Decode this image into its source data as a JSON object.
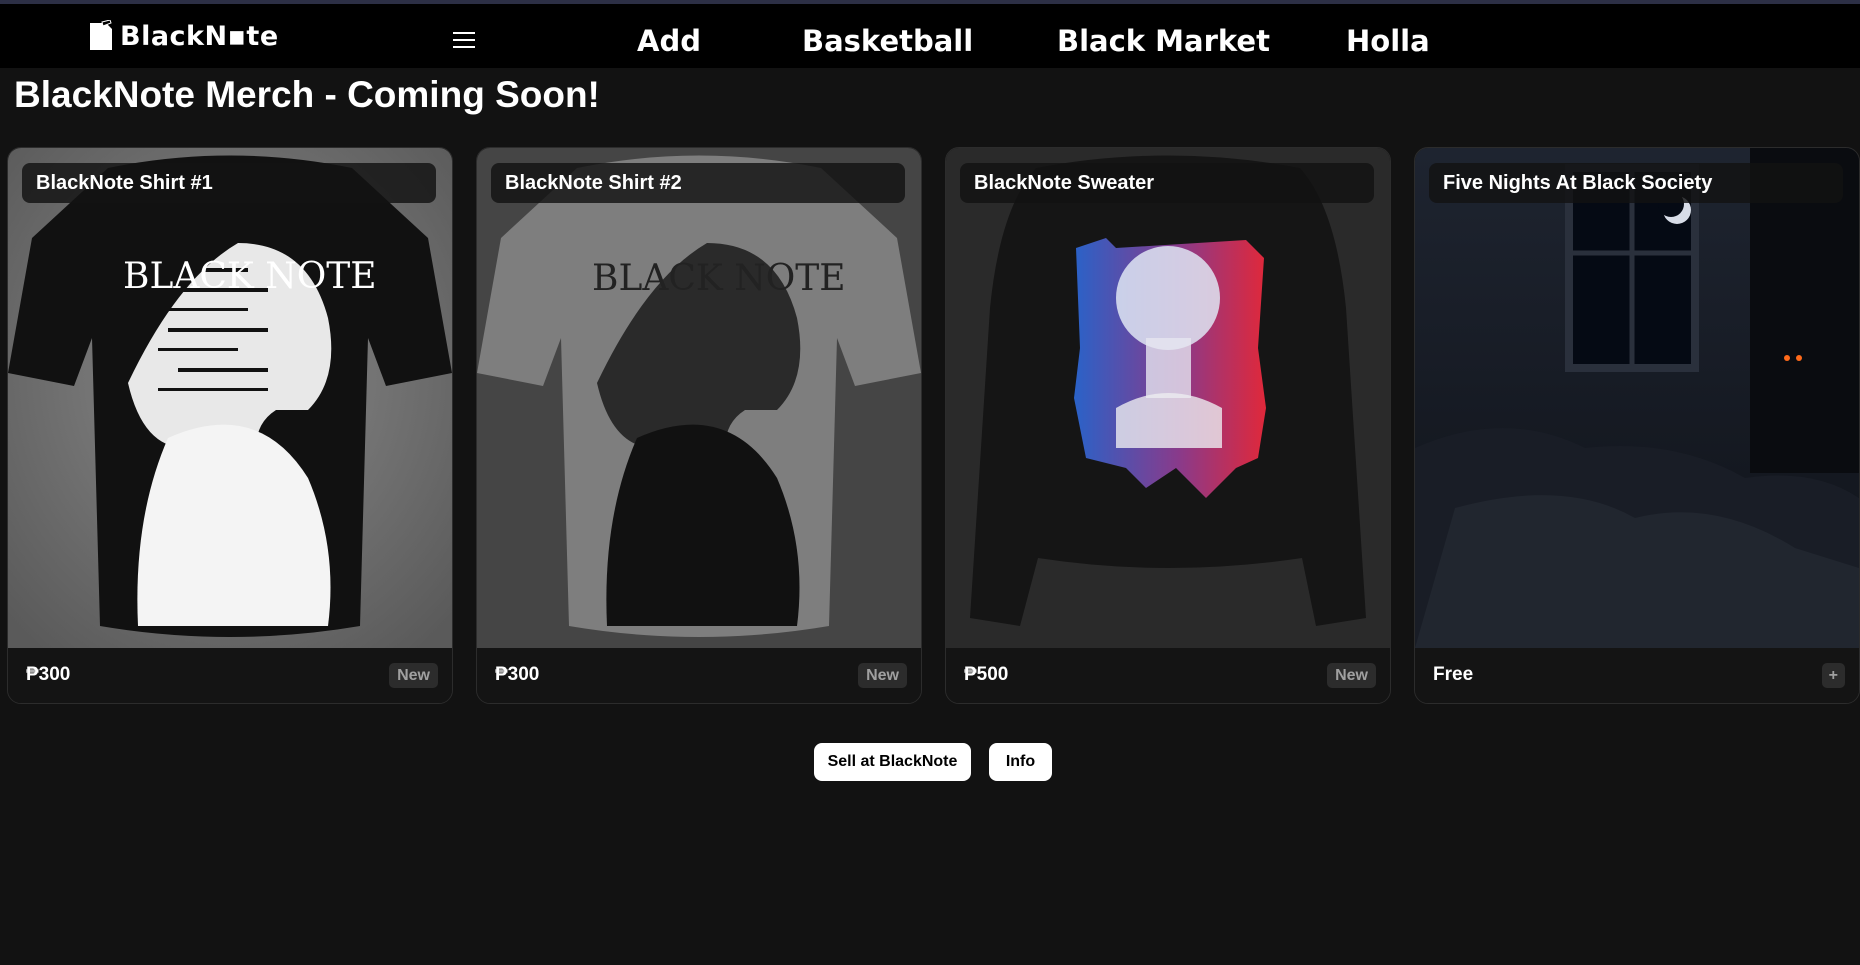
{
  "app": {
    "logo_text": "BlackN▪te",
    "accent": "#ffffff",
    "background": "#121212"
  },
  "header": {
    "menu_icon": "hamburger-icon",
    "nav": [
      {
        "label": "Add"
      },
      {
        "label": "Basketball"
      },
      {
        "label": "Black Market"
      },
      {
        "label": "Holla"
      }
    ]
  },
  "main": {
    "title": "BlackNote Merch - Coming Soon!",
    "products": [
      {
        "name": "BlackNote Shirt #1",
        "price": "₱300",
        "badge": "New",
        "image": "black-tshirt-with-blacknote-print"
      },
      {
        "name": "BlackNote Shirt #2",
        "price": "₱300",
        "badge": "New",
        "image": "grey-tshirt-with-blacknote-print"
      },
      {
        "name": "BlackNote Sweater",
        "price": "₱500",
        "badge": "New",
        "image": "black-sweater-with-blue-red-portrait"
      },
      {
        "name": "Five Nights At Black Society",
        "price": "Free",
        "badge": "+",
        "image": "dark-bedroom-at-night"
      }
    ],
    "actions": {
      "sell_label": "Sell at BlackNote",
      "info_label": "Info"
    }
  }
}
